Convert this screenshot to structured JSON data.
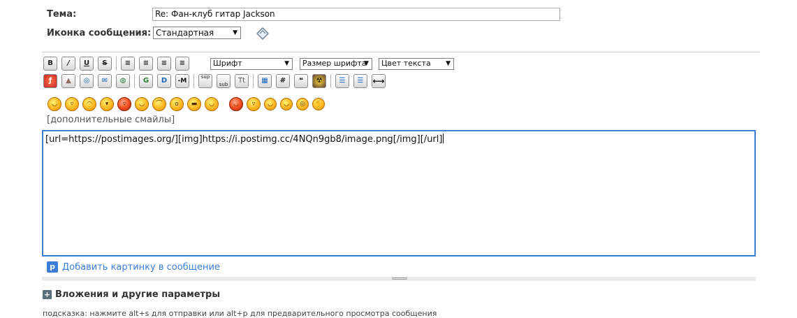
{
  "form": {
    "subject_label": "Тема:",
    "subject_value": "Re: Фан-клуб гитар Jackson",
    "icon_label": "Иконка сообщения:",
    "icon_select_value": "Стандартная"
  },
  "toolbar": {
    "row1": [
      {
        "name": "bold-button",
        "glyph": "B"
      },
      {
        "name": "italic-button",
        "glyph": "/"
      },
      {
        "name": "underline-button",
        "glyph": "U"
      },
      {
        "name": "strikethrough-button",
        "glyph": "S"
      },
      {
        "name": "align-left-button",
        "glyph": "≡"
      },
      {
        "name": "align-justify-button",
        "glyph": "≡"
      },
      {
        "name": "align-center-button",
        "glyph": "≡"
      },
      {
        "name": "align-right-button",
        "glyph": "≡"
      }
    ],
    "font_select": "Шрифт",
    "size_select": "Размер шрифта",
    "color_select": "Цвет текста",
    "row2": [
      {
        "name": "flash-button",
        "glyph": "ƒ"
      },
      {
        "name": "image-button",
        "glyph": "▲"
      },
      {
        "name": "link-button",
        "glyph": "◎"
      },
      {
        "name": "email-button",
        "glyph": "✉"
      },
      {
        "name": "map-button",
        "glyph": "◍"
      },
      {
        "name": "google-button",
        "glyph": "G"
      },
      {
        "name": "d-button",
        "glyph": "D"
      },
      {
        "name": "m-button",
        "glyph": "-M"
      },
      {
        "name": "superscript-button",
        "glyph": "sup"
      },
      {
        "name": "subscript-button",
        "glyph": "sub"
      },
      {
        "name": "tt-button",
        "glyph": "Tt"
      },
      {
        "name": "table-button",
        "glyph": "▦"
      },
      {
        "name": "hash-button",
        "glyph": "#"
      },
      {
        "name": "quote-button",
        "glyph": "❝"
      },
      {
        "name": "spoiler-button",
        "glyph": "☢"
      },
      {
        "name": "bulleted-list-button",
        "glyph": "☰"
      },
      {
        "name": "numbered-list-button",
        "glyph": "☰"
      },
      {
        "name": "hr-button",
        "glyph": "⟷"
      }
    ]
  },
  "smileys": {
    "items": [
      "smile",
      "grin",
      "wink",
      "laugh",
      "angry",
      "happy",
      "sad",
      "shock",
      "cool",
      "wave",
      "tongue-out",
      "crazy",
      "smirk",
      "eyes",
      "dizzy",
      "hide"
    ],
    "more_link": "[дополнительные смайлы]"
  },
  "editor": {
    "content": "[url=https://postimages.org/][img]https://i.postimg.cc/4NQn9gb8/image.png[/img][/url]"
  },
  "postimage": {
    "icon_letter": "p",
    "link_text": "Добавить картинку в сообщение"
  },
  "attachments": {
    "toggle": "+",
    "label": "Вложения и другие параметры"
  },
  "hint": "подсказка: нажмите alt+s для отправки или alt+p для предварительного просмотра сообщения",
  "colors": {
    "accent": "#3b7dd8",
    "editor_border": "#3c7ed6"
  }
}
